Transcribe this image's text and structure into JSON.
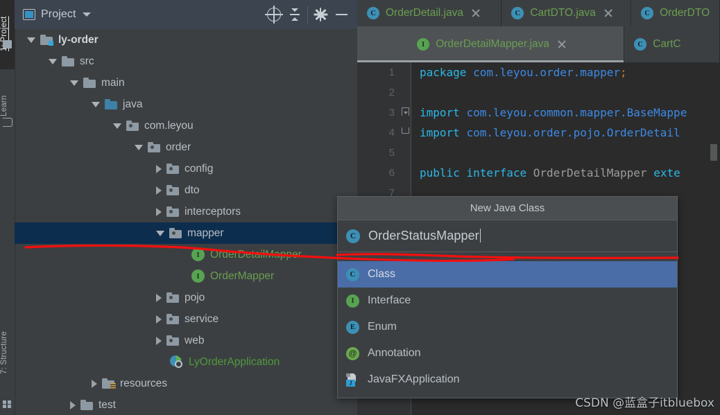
{
  "left_tool_bar": {
    "tabs": [
      {
        "label": "1: Project",
        "active": true
      },
      {
        "label": "Learn",
        "active": false
      },
      {
        "label": "7: Structure",
        "active": false
      }
    ]
  },
  "project_panel": {
    "header": {
      "title": "Project",
      "icons": [
        "project-icon",
        "chevron-down-icon",
        "locate-icon",
        "collapse-all-icon",
        "settings-gear-icon",
        "minimize-icon"
      ]
    },
    "tree": [
      {
        "label": "ly-order",
        "indent": 0,
        "arrow": "open",
        "icon": "module-folder",
        "style": "bold",
        "selected": false
      },
      {
        "label": "src",
        "indent": 1,
        "arrow": "open",
        "icon": "folder",
        "style": "normal",
        "selected": false
      },
      {
        "label": "main",
        "indent": 2,
        "arrow": "open",
        "icon": "folder",
        "style": "normal",
        "selected": false
      },
      {
        "label": "java",
        "indent": 3,
        "arrow": "open",
        "icon": "source-folder",
        "style": "normal",
        "selected": false
      },
      {
        "label": "com.leyou",
        "indent": 4,
        "arrow": "open",
        "icon": "package",
        "style": "normal",
        "selected": false
      },
      {
        "label": "order",
        "indent": 5,
        "arrow": "open",
        "icon": "package",
        "style": "normal",
        "selected": false
      },
      {
        "label": "config",
        "indent": 6,
        "arrow": "closed",
        "icon": "package",
        "style": "normal",
        "selected": false
      },
      {
        "label": "dto",
        "indent": 6,
        "arrow": "closed",
        "icon": "package",
        "style": "normal",
        "selected": false
      },
      {
        "label": "interceptors",
        "indent": 6,
        "arrow": "closed",
        "icon": "package",
        "style": "normal",
        "selected": false
      },
      {
        "label": "mapper",
        "indent": 6,
        "arrow": "open",
        "icon": "package",
        "style": "normal",
        "selected": true
      },
      {
        "label": "OrderDetailMapper",
        "indent": 7,
        "arrow": "none",
        "icon": "interface",
        "style": "green",
        "selected": false
      },
      {
        "label": "OrderMapper",
        "indent": 7,
        "arrow": "none",
        "icon": "interface",
        "style": "green",
        "selected": false
      },
      {
        "label": "pojo",
        "indent": 6,
        "arrow": "closed",
        "icon": "package",
        "style": "normal",
        "selected": false
      },
      {
        "label": "service",
        "indent": 6,
        "arrow": "closed",
        "icon": "package",
        "style": "normal",
        "selected": false
      },
      {
        "label": "web",
        "indent": 6,
        "arrow": "closed",
        "icon": "package",
        "style": "normal",
        "selected": false
      },
      {
        "label": "LyOrderApplication",
        "indent": 6,
        "arrow": "none",
        "icon": "spring-app",
        "style": "greenapp",
        "selected": false
      },
      {
        "label": "resources",
        "indent": 3,
        "arrow": "closed",
        "icon": "resources",
        "style": "normal",
        "selected": false
      },
      {
        "label": "test",
        "indent": 2,
        "arrow": "closed",
        "icon": "folder",
        "style": "normal",
        "selected": false
      }
    ]
  },
  "editor": {
    "tabs_row1": [
      {
        "label": "OrderDetail.java",
        "badge": "C",
        "badge_type": "c",
        "active": false,
        "closable": true
      },
      {
        "label": "CartDTO.java",
        "badge": "C",
        "badge_type": "c",
        "active": false,
        "closable": true
      },
      {
        "label": "OrderDTO",
        "badge": "C",
        "badge_type": "c",
        "active": false,
        "closable": false
      }
    ],
    "tabs_row2": [
      {
        "label": "OrderDetailMapper.java",
        "badge": "I",
        "badge_type": "i",
        "active": true,
        "closable": true
      },
      {
        "label": "CartC",
        "badge": "C",
        "badge_type": "c",
        "active": false,
        "closable": false
      }
    ],
    "code_lines": [
      {
        "num": "1",
        "fold": "",
        "tokens": [
          {
            "t": "package",
            "c": "kw2"
          },
          {
            "t": " ",
            "c": "op"
          },
          {
            "t": "com.leyou.order.mapper",
            "c": "pkgref"
          },
          {
            "t": ";",
            "c": "semi"
          }
        ]
      },
      {
        "num": "2",
        "fold": "",
        "tokens": []
      },
      {
        "num": "3",
        "fold": "top",
        "tokens": [
          {
            "t": "import",
            "c": "kw2"
          },
          {
            "t": " ",
            "c": "op"
          },
          {
            "t": "com.leyou.common.mapper.BaseMappe",
            "c": "pkgref"
          }
        ]
      },
      {
        "num": "4",
        "fold": "bot",
        "tokens": [
          {
            "t": "import",
            "c": "kw2"
          },
          {
            "t": " ",
            "c": "op"
          },
          {
            "t": "com.leyou.order.pojo.OrderDetail",
            "c": "pkgref"
          }
        ]
      },
      {
        "num": "5",
        "fold": "",
        "tokens": []
      },
      {
        "num": "6",
        "fold": "",
        "tokens": [
          {
            "t": "public",
            "c": "kw2"
          },
          {
            "t": " ",
            "c": "op"
          },
          {
            "t": "interface",
            "c": "kw2"
          },
          {
            "t": " ",
            "c": "op"
          },
          {
            "t": "OrderDetailMapper",
            "c": "idn"
          },
          {
            "t": " ",
            "c": "op"
          },
          {
            "t": "exte",
            "c": "kw2"
          }
        ]
      },
      {
        "num": "7",
        "fold": "",
        "tokens": []
      }
    ]
  },
  "dialog": {
    "title": "New Java Class",
    "input": {
      "value": "OrderStatusMapper",
      "badge": "C"
    },
    "items": [
      {
        "label": "Class",
        "badge": "C",
        "badge_type": "c",
        "selected": true
      },
      {
        "label": "Interface",
        "badge": "I",
        "badge_type": "i",
        "selected": false
      },
      {
        "label": "Enum",
        "badge": "E",
        "badge_type": "e",
        "selected": false
      },
      {
        "label": "Annotation",
        "badge": "@",
        "badge_type": "at",
        "selected": false
      },
      {
        "label": "JavaFXApplication",
        "badge": "J",
        "badge_type": "fx",
        "selected": false
      }
    ]
  },
  "watermark": {
    "text": "CSDN @蓝盒子itbluebox"
  },
  "colors": {
    "selection_navy": "#0d2d4e",
    "list_selection_blue": "#4a6da7",
    "annotation_red": "#f40f0f",
    "interface_green": "#58a352",
    "class_blue": "#3d90b5",
    "code_keyword": "#2bb8e8",
    "code_reference": "#3d8ae6",
    "panel_bg": "#3c3f41",
    "editor_bg": "#2b2b2b"
  }
}
